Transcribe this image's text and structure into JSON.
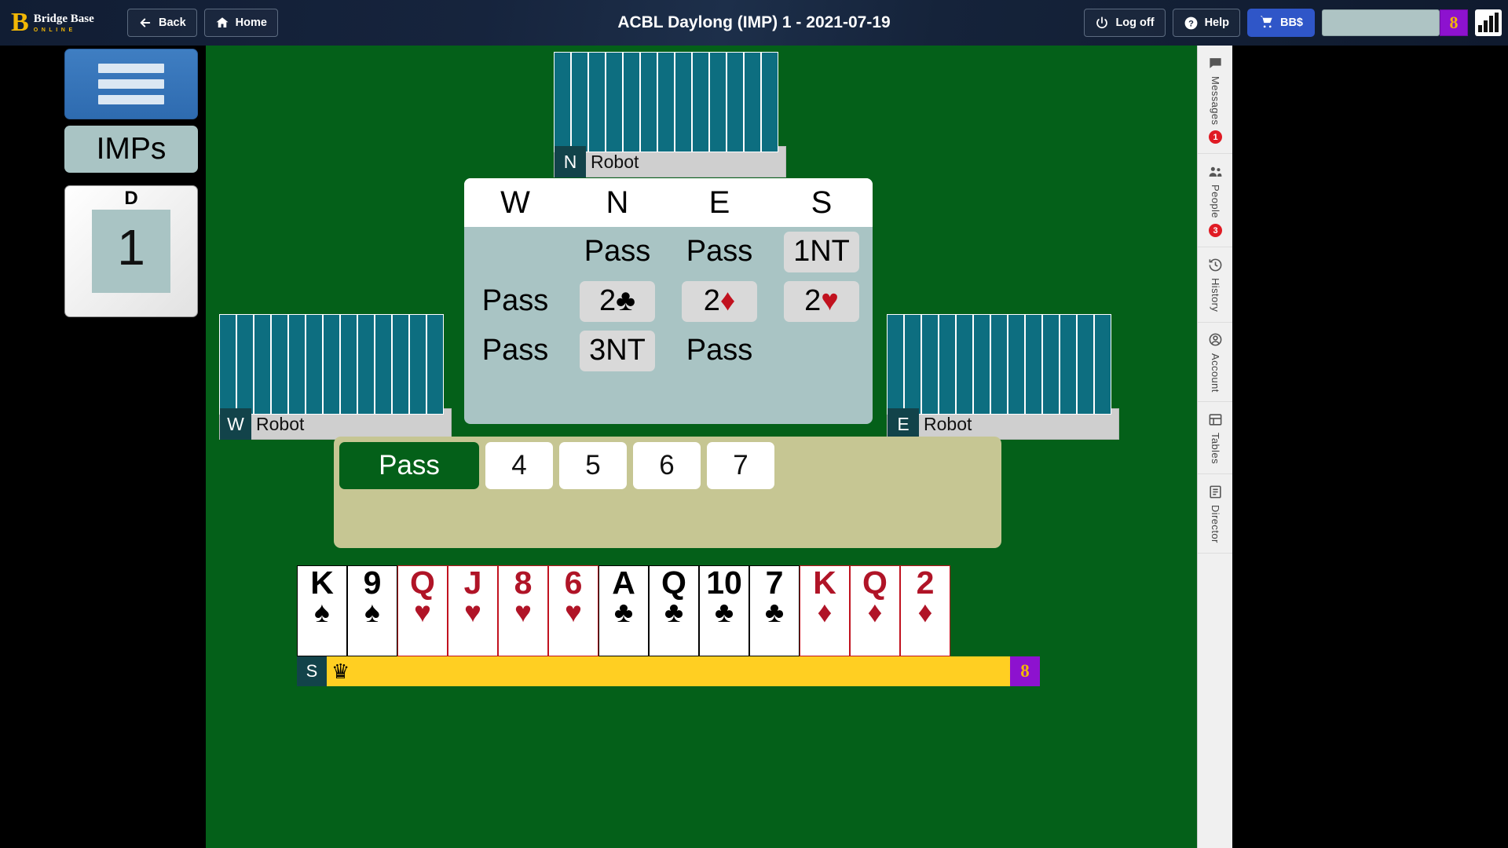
{
  "header": {
    "logo_main": "Bridge Base",
    "logo_sub": "ONLINE",
    "logo_mark": "B",
    "back_label": "Back",
    "home_label": "Home",
    "title": "ACBL Daylong (IMP) 1 - 2021-07-19",
    "logoff_label": "Log off",
    "help_label": "Help",
    "bbs_label": "BB$",
    "account_badge": "8",
    "accent_blue": "#2f56c8",
    "badge_purple": "#8d12cf",
    "badge_gold": "#f2b705"
  },
  "left_panel": {
    "menu_label": "menu",
    "scoring_label": "IMPs",
    "board": {
      "dealer": "D",
      "number": "1"
    }
  },
  "seats": {
    "north": {
      "dir": "N",
      "name": "Robot",
      "cards_back": 13
    },
    "west": {
      "dir": "W",
      "name": "Robot",
      "cards_back": 13
    },
    "east": {
      "dir": "E",
      "name": "Robot",
      "cards_back": 13
    },
    "south": {
      "dir": "S",
      "name": "",
      "badge": "8",
      "crown": "♛"
    }
  },
  "auction": {
    "headers": [
      "W",
      "N",
      "E",
      "S"
    ],
    "rows": [
      [
        {
          "text": "",
          "chip": false,
          "suit": ""
        },
        {
          "text": "Pass",
          "chip": false,
          "suit": ""
        },
        {
          "text": "Pass",
          "chip": false,
          "suit": ""
        },
        {
          "text": "1NT",
          "chip": true,
          "suit": ""
        }
      ],
      [
        {
          "text": "Pass",
          "chip": false,
          "suit": ""
        },
        {
          "text": "2",
          "chip": true,
          "suit": "♣"
        },
        {
          "text": "2",
          "chip": true,
          "suit": "♦"
        },
        {
          "text": "2",
          "chip": true,
          "suit": "♥"
        }
      ],
      [
        {
          "text": "Pass",
          "chip": false,
          "suit": ""
        },
        {
          "text": "3NT",
          "chip": true,
          "suit": ""
        },
        {
          "text": "Pass",
          "chip": false,
          "suit": ""
        },
        {
          "text": "",
          "chip": false,
          "suit": ""
        }
      ]
    ]
  },
  "bidding_box": {
    "pass_label": "Pass",
    "levels": [
      "4",
      "5",
      "6",
      "7"
    ]
  },
  "hand": [
    {
      "rank": "K",
      "suit": "♠",
      "color": "blk"
    },
    {
      "rank": "9",
      "suit": "♠",
      "color": "blk"
    },
    {
      "rank": "Q",
      "suit": "♥",
      "color": "red"
    },
    {
      "rank": "J",
      "suit": "♥",
      "color": "red"
    },
    {
      "rank": "8",
      "suit": "♥",
      "color": "red"
    },
    {
      "rank": "6",
      "suit": "♥",
      "color": "red"
    },
    {
      "rank": "A",
      "suit": "♣",
      "color": "blk"
    },
    {
      "rank": "Q",
      "suit": "♣",
      "color": "blk"
    },
    {
      "rank": "10",
      "suit": "♣",
      "color": "blk"
    },
    {
      "rank": "7",
      "suit": "♣",
      "color": "blk"
    },
    {
      "rank": "K",
      "suit": "♦",
      "color": "red"
    },
    {
      "rank": "Q",
      "suit": "♦",
      "color": "red"
    },
    {
      "rank": "2",
      "suit": "♦",
      "color": "red"
    }
  ],
  "right_sidebar": [
    {
      "label": "Messages",
      "icon": "chat-icon",
      "badge": "1"
    },
    {
      "label": "People",
      "icon": "people-icon",
      "badge": "3"
    },
    {
      "label": "History",
      "icon": "history-icon",
      "badge": ""
    },
    {
      "label": "Account",
      "icon": "account-icon",
      "badge": ""
    },
    {
      "label": "Tables",
      "icon": "tables-icon",
      "badge": ""
    },
    {
      "label": "Director",
      "icon": "director-icon",
      "badge": ""
    }
  ]
}
